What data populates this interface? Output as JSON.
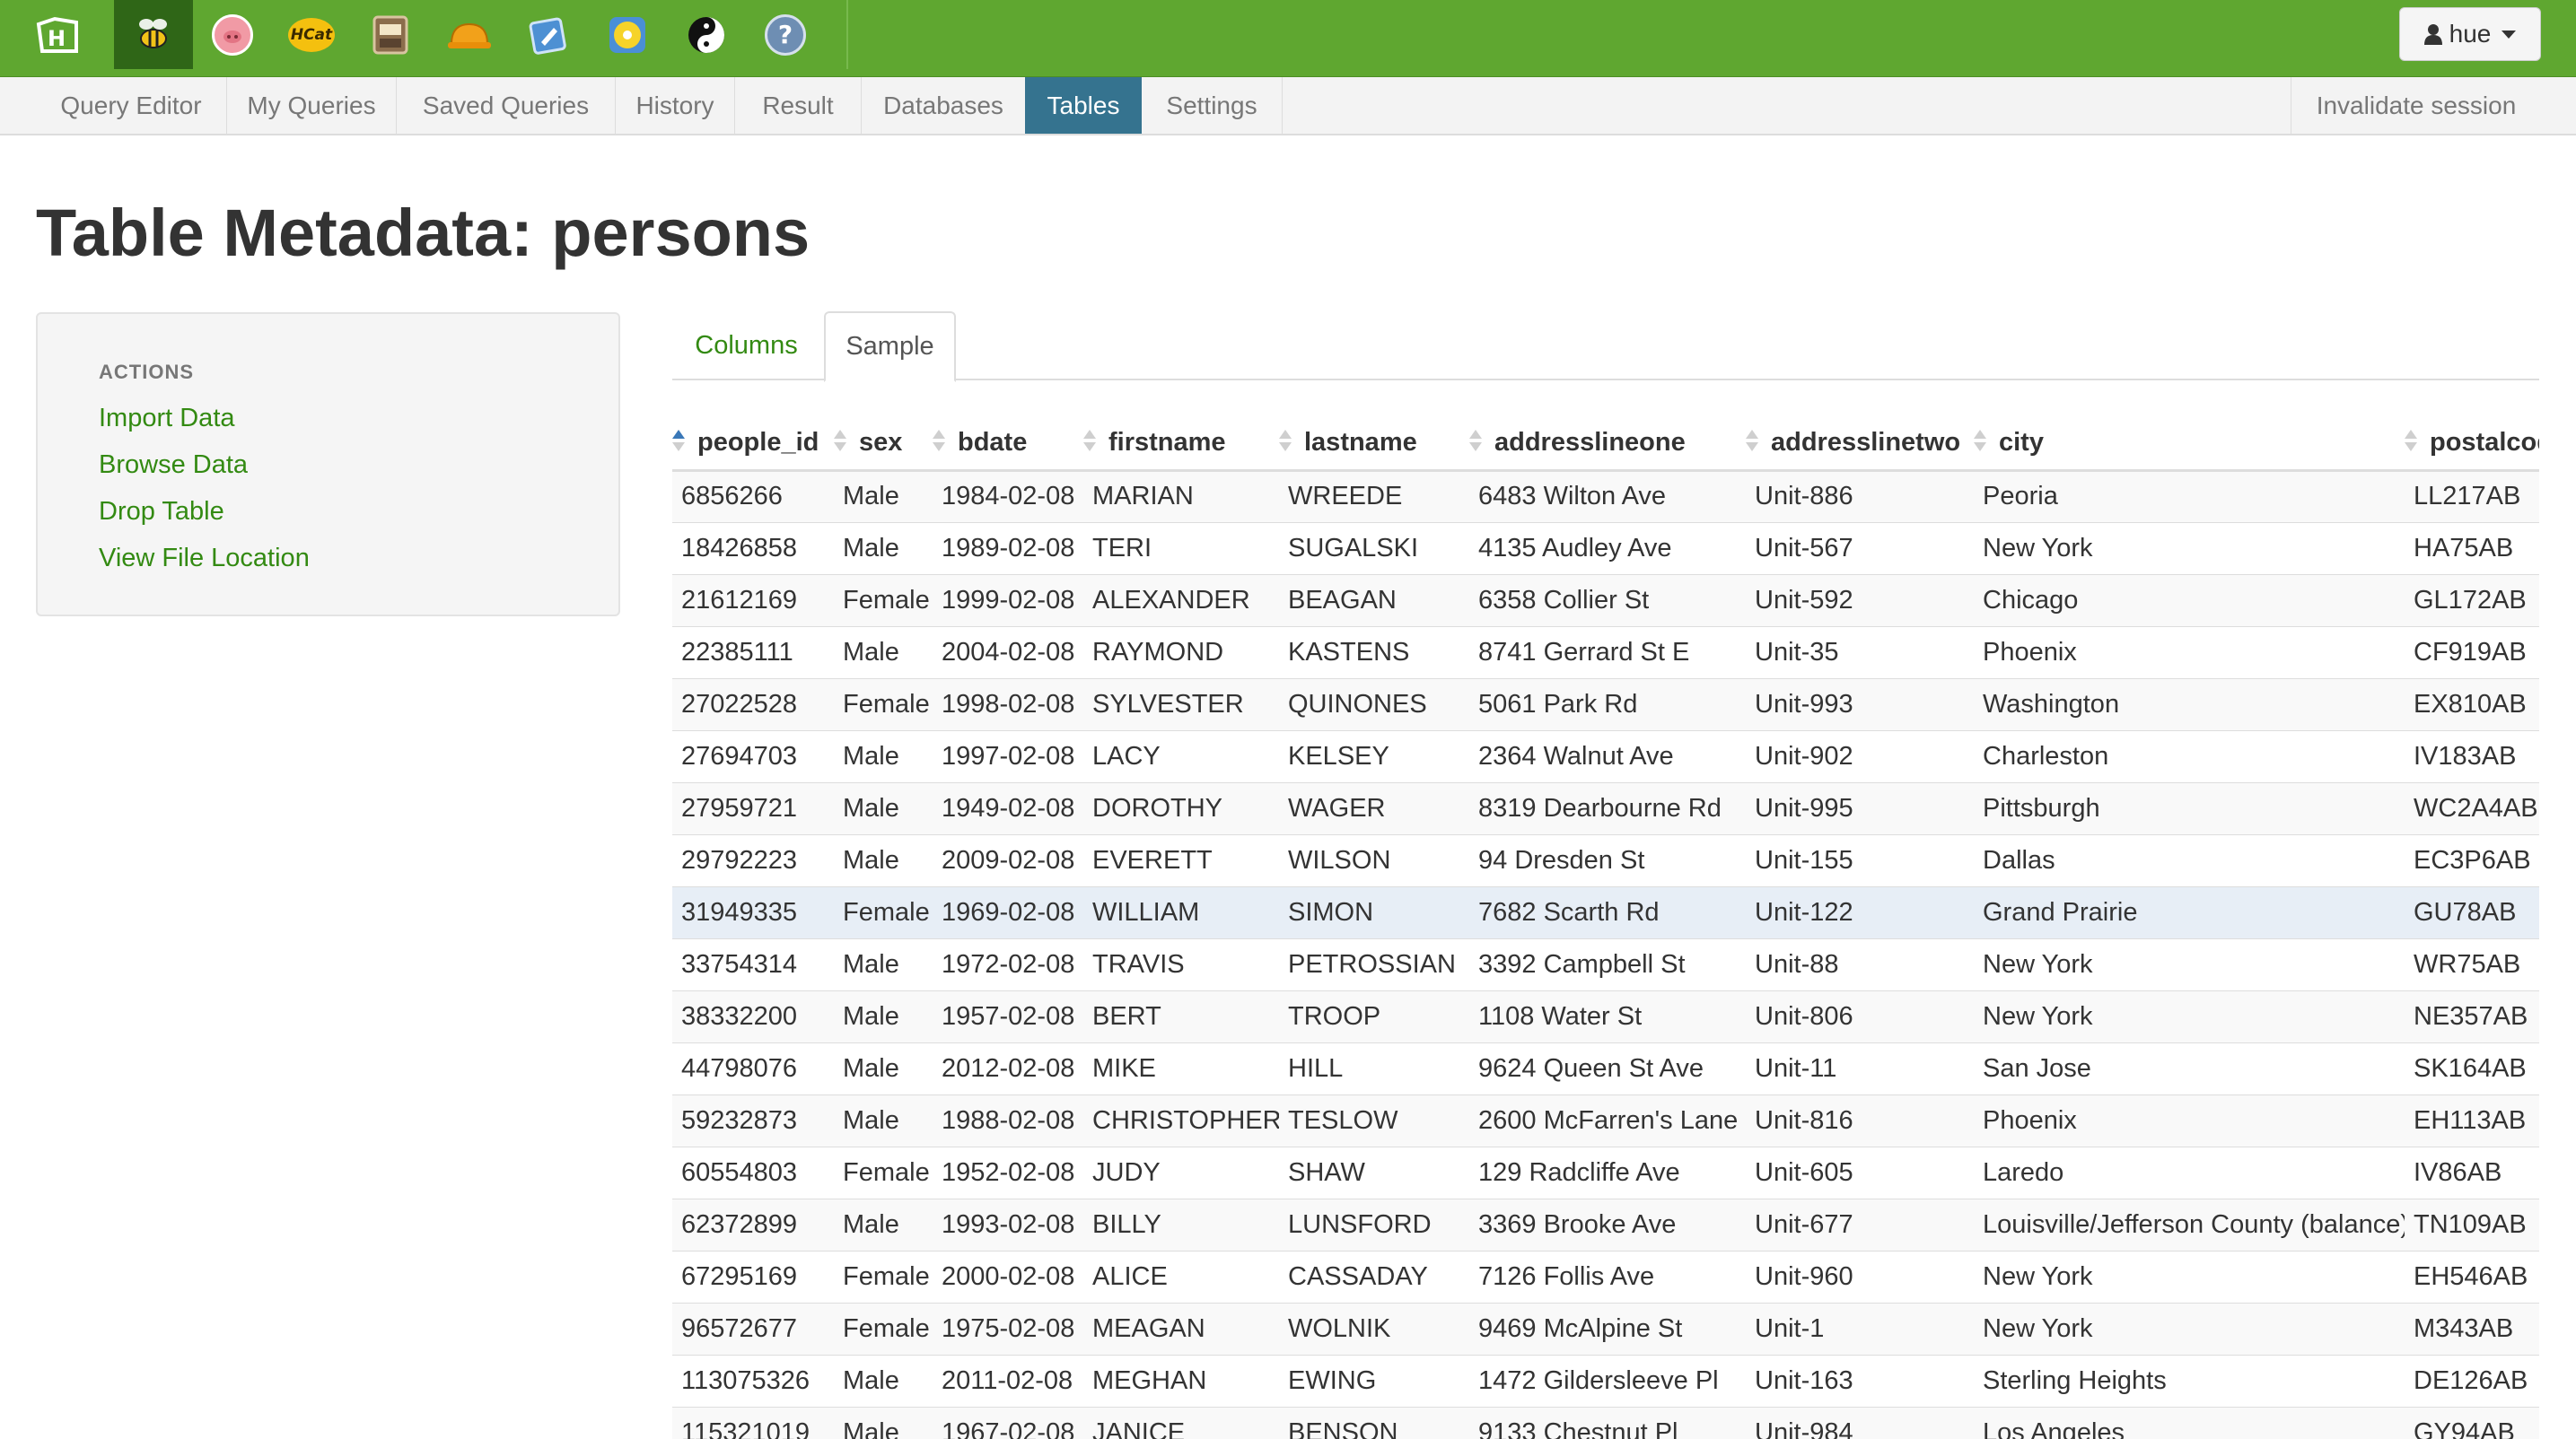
{
  "topbar": {
    "apps": [
      {
        "icon": "hue-logo-icon",
        "color": "#ffffff"
      },
      {
        "icon": "beeswax-bee-icon",
        "color": "#f2c318"
      },
      {
        "icon": "pig-icon",
        "color": "#f19aa5"
      },
      {
        "icon": "hcatalog-icon",
        "label": "HCat",
        "color": "#f4c00f"
      },
      {
        "icon": "file-browser-icon",
        "color": "#8b6d4c"
      },
      {
        "icon": "job-designer-hardhat-icon",
        "color": "#f2a11a"
      },
      {
        "icon": "oozie-icon",
        "color": "#4d90d3"
      },
      {
        "icon": "cd-disc-icon",
        "color": "#f6d329"
      },
      {
        "icon": "yin-yang-icon",
        "color": "#111111"
      },
      {
        "icon": "help-icon",
        "label": "?",
        "color": "#6e8eb3"
      }
    ],
    "user_label": "hue"
  },
  "subnav": {
    "items": [
      "Query Editor",
      "My Queries",
      "Saved Queries",
      "History",
      "Result",
      "Databases",
      "Tables",
      "Settings"
    ],
    "active": "Tables",
    "invalidate_label": "Invalidate session"
  },
  "page": {
    "title": "Table Metadata: persons"
  },
  "sidebar": {
    "header": "ACTIONS",
    "links": [
      "Import Data",
      "Browse Data",
      "Drop Table",
      "View File Location"
    ]
  },
  "tabs": {
    "columns_label": "Columns",
    "sample_label": "Sample",
    "active": "Sample"
  },
  "table": {
    "columns": [
      "people_id",
      "sex",
      "bdate",
      "firstname",
      "lastname",
      "addresslineone",
      "addresslinetwo",
      "city",
      "postalcode"
    ],
    "sorted_column": "people_id",
    "highlighted_row": 8,
    "rows": [
      [
        "6856266",
        "Male",
        "1984-02-08",
        "MARIAN",
        "WREEDE",
        "6483 Wilton Ave",
        "Unit-886",
        "Peoria",
        "LL217AB"
      ],
      [
        "18426858",
        "Male",
        "1989-02-08",
        "TERI",
        "SUGALSKI",
        "4135 Audley Ave",
        "Unit-567",
        "New York",
        "HA75AB"
      ],
      [
        "21612169",
        "Female",
        "1999-02-08",
        "ALEXANDER",
        "BEAGAN",
        "6358 Collier St",
        "Unit-592",
        "Chicago",
        "GL172AB"
      ],
      [
        "22385111",
        "Male",
        "2004-02-08",
        "RAYMOND",
        "KASTENS",
        "8741 Gerrard St E",
        "Unit-35",
        "Phoenix",
        "CF919AB"
      ],
      [
        "27022528",
        "Female",
        "1998-02-08",
        "SYLVESTER",
        "QUINONES",
        "5061 Park Rd",
        "Unit-993",
        "Washington",
        "EX810AB"
      ],
      [
        "27694703",
        "Male",
        "1997-02-08",
        "LACY",
        "KELSEY",
        "2364 Walnut Ave",
        "Unit-902",
        "Charleston",
        "IV183AB"
      ],
      [
        "27959721",
        "Male",
        "1949-02-08",
        "DOROTHY",
        "WAGER",
        "8319 Dearbourne Rd",
        "Unit-995",
        "Pittsburgh",
        "WC2A4AB"
      ],
      [
        "29792223",
        "Male",
        "2009-02-08",
        "EVERETT",
        "WILSON",
        "94 Dresden St",
        "Unit-155",
        "Dallas",
        "EC3P6AB"
      ],
      [
        "31949335",
        "Female",
        "1969-02-08",
        "WILLIAM",
        "SIMON",
        "7682 Scarth Rd",
        "Unit-122",
        "Grand Prairie",
        "GU78AB"
      ],
      [
        "33754314",
        "Male",
        "1972-02-08",
        "TRAVIS",
        "PETROSSIAN",
        "3392 Campbell St",
        "Unit-88",
        "New York",
        "WR75AB"
      ],
      [
        "38332200",
        "Male",
        "1957-02-08",
        "BERT",
        "TROOP",
        "1108 Water St",
        "Unit-806",
        "New York",
        "NE357AB"
      ],
      [
        "44798076",
        "Male",
        "2012-02-08",
        "MIKE",
        "HILL",
        "9624 Queen St Ave",
        "Unit-11",
        "San Jose",
        "SK164AB"
      ],
      [
        "59232873",
        "Male",
        "1988-02-08",
        "CHRISTOPHER",
        "TESLOW",
        "2600 McFarren's Lane",
        "Unit-816",
        "Phoenix",
        "EH113AB"
      ],
      [
        "60554803",
        "Female",
        "1952-02-08",
        "JUDY",
        "SHAW",
        "129 Radcliffe Ave",
        "Unit-605",
        "Laredo",
        "IV86AB"
      ],
      [
        "62372899",
        "Male",
        "1993-02-08",
        "BILLY",
        "LUNSFORD",
        "3369 Brooke Ave",
        "Unit-677",
        "Louisville/Jefferson County (balance)",
        "TN109AB"
      ],
      [
        "67295169",
        "Female",
        "2000-02-08",
        "ALICE",
        "CASSADAY",
        "7126 Follis Ave",
        "Unit-960",
        "New York",
        "EH546AB"
      ],
      [
        "96572677",
        "Female",
        "1975-02-08",
        "MEAGAN",
        "WOLNIK",
        "9469 McAlpine St",
        "Unit-1",
        "New York",
        "M343AB"
      ],
      [
        "113075326",
        "Male",
        "2011-02-08",
        "MEGHAN",
        "EWING",
        "1472 Gildersleeve Pl",
        "Unit-163",
        "Sterling Heights",
        "DE126AB"
      ],
      [
        "115321019",
        "Male",
        "1967-02-08",
        "JANICE",
        "BENSON",
        "9133 Chestnut Pl",
        "Unit-984",
        "Los Angeles",
        "GY94AB"
      ]
    ]
  }
}
